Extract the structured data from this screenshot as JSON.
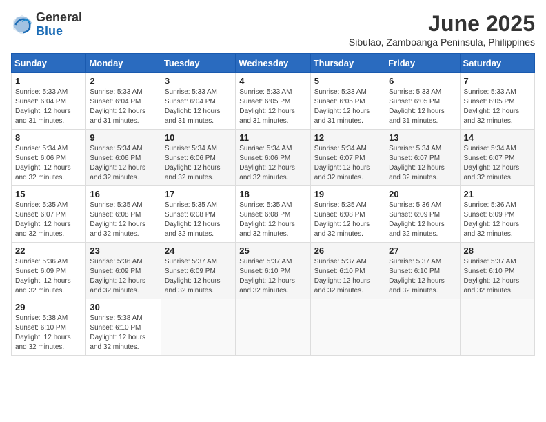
{
  "header": {
    "logo_general": "General",
    "logo_blue": "Blue",
    "month_title": "June 2025",
    "location": "Sibulao, Zamboanga Peninsula, Philippines"
  },
  "weekdays": [
    "Sunday",
    "Monday",
    "Tuesday",
    "Wednesday",
    "Thursday",
    "Friday",
    "Saturday"
  ],
  "weeks": [
    {
      "days": [
        {
          "num": "1",
          "sunrise": "5:33 AM",
          "sunset": "6:04 PM",
          "daylight": "12 hours and 31 minutes."
        },
        {
          "num": "2",
          "sunrise": "5:33 AM",
          "sunset": "6:04 PM",
          "daylight": "12 hours and 31 minutes."
        },
        {
          "num": "3",
          "sunrise": "5:33 AM",
          "sunset": "6:04 PM",
          "daylight": "12 hours and 31 minutes."
        },
        {
          "num": "4",
          "sunrise": "5:33 AM",
          "sunset": "6:05 PM",
          "daylight": "12 hours and 31 minutes."
        },
        {
          "num": "5",
          "sunrise": "5:33 AM",
          "sunset": "6:05 PM",
          "daylight": "12 hours and 31 minutes."
        },
        {
          "num": "6",
          "sunrise": "5:33 AM",
          "sunset": "6:05 PM",
          "daylight": "12 hours and 31 minutes."
        },
        {
          "num": "7",
          "sunrise": "5:33 AM",
          "sunset": "6:05 PM",
          "daylight": "12 hours and 32 minutes."
        }
      ]
    },
    {
      "days": [
        {
          "num": "8",
          "sunrise": "5:34 AM",
          "sunset": "6:06 PM",
          "daylight": "12 hours and 32 minutes."
        },
        {
          "num": "9",
          "sunrise": "5:34 AM",
          "sunset": "6:06 PM",
          "daylight": "12 hours and 32 minutes."
        },
        {
          "num": "10",
          "sunrise": "5:34 AM",
          "sunset": "6:06 PM",
          "daylight": "12 hours and 32 minutes."
        },
        {
          "num": "11",
          "sunrise": "5:34 AM",
          "sunset": "6:06 PM",
          "daylight": "12 hours and 32 minutes."
        },
        {
          "num": "12",
          "sunrise": "5:34 AM",
          "sunset": "6:07 PM",
          "daylight": "12 hours and 32 minutes."
        },
        {
          "num": "13",
          "sunrise": "5:34 AM",
          "sunset": "6:07 PM",
          "daylight": "12 hours and 32 minutes."
        },
        {
          "num": "14",
          "sunrise": "5:34 AM",
          "sunset": "6:07 PM",
          "daylight": "12 hours and 32 minutes."
        }
      ]
    },
    {
      "days": [
        {
          "num": "15",
          "sunrise": "5:35 AM",
          "sunset": "6:07 PM",
          "daylight": "12 hours and 32 minutes."
        },
        {
          "num": "16",
          "sunrise": "5:35 AM",
          "sunset": "6:08 PM",
          "daylight": "12 hours and 32 minutes."
        },
        {
          "num": "17",
          "sunrise": "5:35 AM",
          "sunset": "6:08 PM",
          "daylight": "12 hours and 32 minutes."
        },
        {
          "num": "18",
          "sunrise": "5:35 AM",
          "sunset": "6:08 PM",
          "daylight": "12 hours and 32 minutes."
        },
        {
          "num": "19",
          "sunrise": "5:35 AM",
          "sunset": "6:08 PM",
          "daylight": "12 hours and 32 minutes."
        },
        {
          "num": "20",
          "sunrise": "5:36 AM",
          "sunset": "6:09 PM",
          "daylight": "12 hours and 32 minutes."
        },
        {
          "num": "21",
          "sunrise": "5:36 AM",
          "sunset": "6:09 PM",
          "daylight": "12 hours and 32 minutes."
        }
      ]
    },
    {
      "days": [
        {
          "num": "22",
          "sunrise": "5:36 AM",
          "sunset": "6:09 PM",
          "daylight": "12 hours and 32 minutes."
        },
        {
          "num": "23",
          "sunrise": "5:36 AM",
          "sunset": "6:09 PM",
          "daylight": "12 hours and 32 minutes."
        },
        {
          "num": "24",
          "sunrise": "5:37 AM",
          "sunset": "6:09 PM",
          "daylight": "12 hours and 32 minutes."
        },
        {
          "num": "25",
          "sunrise": "5:37 AM",
          "sunset": "6:10 PM",
          "daylight": "12 hours and 32 minutes."
        },
        {
          "num": "26",
          "sunrise": "5:37 AM",
          "sunset": "6:10 PM",
          "daylight": "12 hours and 32 minutes."
        },
        {
          "num": "27",
          "sunrise": "5:37 AM",
          "sunset": "6:10 PM",
          "daylight": "12 hours and 32 minutes."
        },
        {
          "num": "28",
          "sunrise": "5:37 AM",
          "sunset": "6:10 PM",
          "daylight": "12 hours and 32 minutes."
        }
      ]
    },
    {
      "days": [
        {
          "num": "29",
          "sunrise": "5:38 AM",
          "sunset": "6:10 PM",
          "daylight": "12 hours and 32 minutes."
        },
        {
          "num": "30",
          "sunrise": "5:38 AM",
          "sunset": "6:10 PM",
          "daylight": "12 hours and 32 minutes."
        },
        null,
        null,
        null,
        null,
        null
      ]
    }
  ],
  "labels": {
    "sunrise": "Sunrise:",
    "sunset": "Sunset:",
    "daylight": "Daylight:"
  }
}
